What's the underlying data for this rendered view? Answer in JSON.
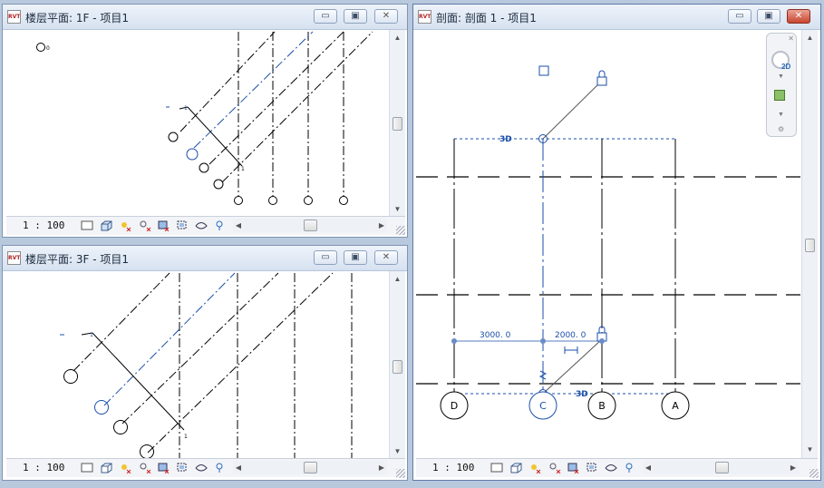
{
  "windows": {
    "floor1": {
      "title": "楼层平面: 1F - 项目1",
      "scale": "1 : 100",
      "tag_small": "0",
      "level_marks": [
        "1",
        "1"
      ]
    },
    "floor3": {
      "title": "楼层平面: 3F - 项目1",
      "scale": "1 : 100",
      "level_marks": [
        "1",
        "1"
      ]
    },
    "section": {
      "title": "剖面: 剖面 1 - 项目1",
      "scale": "1 : 100",
      "label_3d_top": "3D",
      "label_3d_bottom": "3D",
      "dim_left": "3000. 0",
      "dim_right": "2000. 0",
      "grids": [
        "D",
        "C",
        "B",
        "A"
      ],
      "navbar": {
        "badge": "2D"
      }
    }
  },
  "rvt_label": "RVT",
  "controls": {
    "minimize": "▭",
    "restore": "▣",
    "close": "✕"
  },
  "colors": {
    "accent": "#1a4fa8",
    "titlebar": "#dfe8f4",
    "close_active": "#c8452f"
  }
}
